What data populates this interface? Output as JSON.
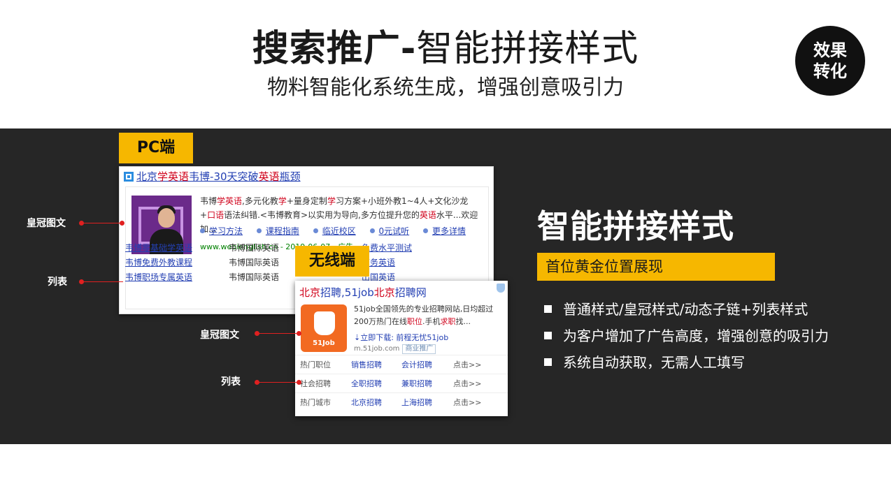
{
  "header": {
    "title_bold": "搜索推广-",
    "title_light": "智能拼接样式",
    "subtitle": "物料智能化系统生成，增强创意吸引力",
    "badge_line1": "效果",
    "badge_line2": "转化"
  },
  "tags": {
    "pc": "PC端",
    "mobile": "无线端"
  },
  "pc_ad": {
    "title_parts": [
      "北京",
      "学英语",
      "韦博-30天突破",
      "英语",
      "瓶颈"
    ],
    "desc_parts": [
      "韦博",
      "学英语",
      ",多元化教",
      "学",
      "+量身定制",
      "学",
      "习方案+小班外教1~4人+文化沙龙+",
      "口",
      "语",
      "语法纠错.<韦博教育>以实用为导向,多方位提升您的",
      "英语",
      "水平...欢迎加..."
    ],
    "links": [
      "学习方法",
      "课程指南",
      "临近校区",
      "0元试听",
      "更多详情"
    ],
    "url": "www.webienglish.cn - 2019-06-07 - 广告",
    "list": [
      [
        "韦博零基础学英语",
        "韦博国际英语",
        "免费水平测试"
      ],
      [
        "韦博免费外教课程",
        "韦博国际英语",
        "商务英语"
      ],
      [
        "韦博职场专属英语",
        "韦博国际英语",
        "出国英语"
      ]
    ]
  },
  "mobile_ad": {
    "title_parts": [
      "北京",
      "招聘,51job",
      "北京",
      "招聘网"
    ],
    "logo_text": "51Job",
    "desc_parts": [
      "51job全国领先的专业招聘网站,日均超过200万热门在线",
      "职位",
      ".手机",
      "求职",
      "找..."
    ],
    "download": "⇣立即下载: 前程无忧51job",
    "url": "m.51job.com",
    "ad_label": "商业推广",
    "grid": [
      [
        "热门职位",
        "销售招聘",
        "会计招聘",
        "点击>>"
      ],
      [
        "社会招聘",
        "全职招聘",
        "兼职招聘",
        "点击>>"
      ],
      [
        "热门城市",
        "北京招聘",
        "上海招聘",
        "点击>>"
      ]
    ]
  },
  "callouts": {
    "pc_crown": "皇冠图文",
    "pc_list": "列表",
    "m_crown": "皇冠图文",
    "m_list": "列表"
  },
  "right": {
    "title": "智能拼接样式",
    "bar": "首位黄金位置展现",
    "bullets": [
      "普通样式/皇冠样式/动态子链+列表样式",
      "为客户增加了广告高度，增强创意的吸引力",
      "系统自动获取，无需人工填写"
    ]
  },
  "colors": {
    "accent": "#f6b700",
    "band": "#262626",
    "link": "#2440b3",
    "keyword": "#d0021b"
  }
}
